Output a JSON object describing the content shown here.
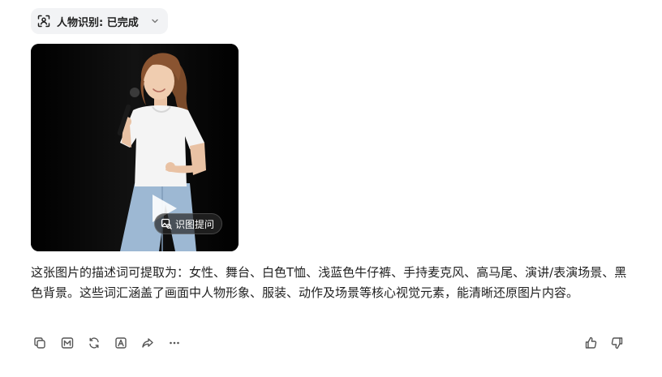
{
  "status": {
    "label": "人物识别: 已完成",
    "icon": "face-scan-icon",
    "chevron_icon": "chevron-down-icon"
  },
  "image": {
    "caption_button_label": "识图提问",
    "caption_button_icon": "image-search-icon"
  },
  "answer": {
    "text": "这张图片的描述词可提取为：女性、舞台、白色T恤、浅蓝色牛仔裤、手持麦克风、高马尾、演讲/表演场景、黑色背景。这些词汇涵盖了画面中人物形象、服装、动作及场景等核心视觉元素，能清晰还原图片内容。"
  },
  "actions": {
    "left": [
      "copy-icon",
      "markdown-icon",
      "regenerate-icon",
      "export-icon",
      "share-icon",
      "more-icon"
    ],
    "right": [
      "thumbs-up-icon",
      "thumbs-down-icon"
    ]
  },
  "colors": {
    "chip_background": "#f2f3f5",
    "text": "#1f1f1f",
    "icon": "#555555",
    "image_background": "#060606"
  }
}
